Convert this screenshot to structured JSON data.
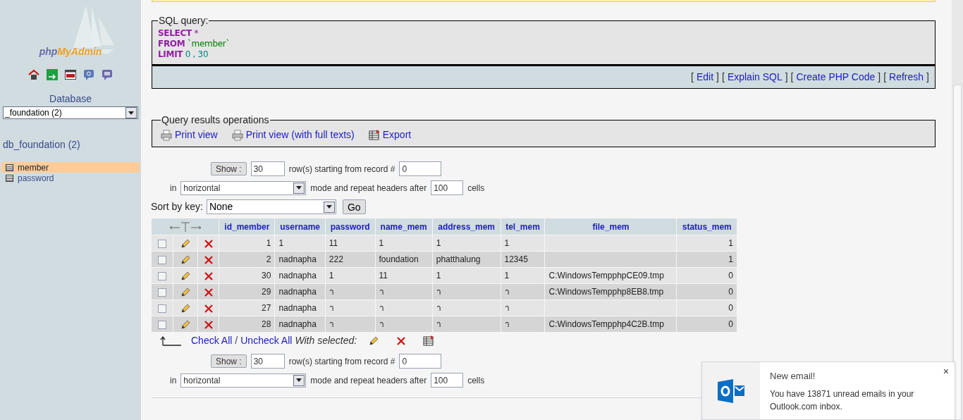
{
  "sidebar": {
    "logo": {
      "part_1": "php",
      "part_2": "MyAdmin"
    },
    "database_label": "Database",
    "database_select": "_foundation (2)",
    "database_title": "db_foundation (2)",
    "tables": [
      {
        "label": "member",
        "selected": true
      },
      {
        "label": "password",
        "selected": false
      }
    ]
  },
  "sql_query": {
    "legend": "SQL query:",
    "lines": [
      {
        "keyword": "SELECT",
        "rest": "*",
        "kind": "operator"
      },
      {
        "keyword": "FROM",
        "rest": "`member`",
        "kind": "identifier"
      },
      {
        "keyword": "LIMIT",
        "rest": "0 , 30",
        "kind": "number"
      }
    ],
    "links": [
      {
        "open": "[",
        "label": "Edit",
        "close": "]"
      },
      {
        "open": "[",
        "label": "Explain SQL",
        "close": "]"
      },
      {
        "open": "[",
        "label": "Create PHP Code",
        "close": "]"
      },
      {
        "open": "[",
        "label": "Refresh",
        "close": "]"
      }
    ]
  },
  "operations": {
    "legend": "Query results operations",
    "links": [
      {
        "label": "Print view",
        "kind": "print"
      },
      {
        "label": "Print view (with full texts)",
        "kind": "print"
      },
      {
        "label": "Export",
        "kind": "export"
      }
    ]
  },
  "navigation": [
    {
      "show": "Show :",
      "rows": "30",
      "rows_label": "row(s) starting from record #",
      "start": "0",
      "in_label": "in",
      "mode": "horizontal",
      "repeat_label": "mode and repeat headers after",
      "repeat": "100",
      "cells_label": "cells"
    },
    {
      "show": "Show :",
      "rows": "30",
      "rows_label": "row(s) starting from record #",
      "start": "0",
      "in_label": "in",
      "mode": "horizontal",
      "repeat_label": "mode and repeat headers after",
      "repeat": "100",
      "cells_label": "cells"
    }
  ],
  "sort": {
    "label": "Sort by key:",
    "value": "None",
    "button": "Go"
  },
  "table": {
    "columns": [
      "id_member",
      "username",
      "password",
      "name_mem",
      "address_mem",
      "tel_mem",
      "file_mem",
      "status_mem"
    ],
    "rows": [
      {
        "checked": false,
        "cells": [
          "1",
          "1",
          "11",
          "1",
          "1",
          "1",
          "",
          "1"
        ]
      },
      {
        "checked": false,
        "cells": [
          "2",
          "nadnapha",
          "222",
          "foundation",
          "phatthalung",
          "12345",
          "",
          "1"
        ]
      },
      {
        "checked": false,
        "cells": [
          "30",
          "nadnapha",
          "1",
          "11",
          "1",
          "1",
          "C:WindowsTempphpCE09.tmp",
          "0"
        ]
      },
      {
        "checked": false,
        "cells": [
          "29",
          "nadnapha",
          "า",
          "า",
          "า",
          "า",
          "C:WindowsTempphp8EB8.tmp",
          "0"
        ]
      },
      {
        "checked": false,
        "cells": [
          "27",
          "nadnapha",
          "า",
          "า",
          "า",
          "า",
          "",
          "0"
        ]
      },
      {
        "checked": false,
        "cells": [
          "28",
          "nadnapha",
          "า",
          "า",
          "า",
          "า",
          "C:WindowsTempphp4C2B.tmp",
          "0"
        ]
      }
    ]
  },
  "selection": {
    "check_all": "Check All",
    "separator": "/",
    "uncheck_all": "Uncheck All",
    "with_selected": "With selected:"
  },
  "notification": {
    "title": "New email!",
    "body": "You have 13871 unread emails in your Outlook.com inbox.",
    "close": "×"
  }
}
